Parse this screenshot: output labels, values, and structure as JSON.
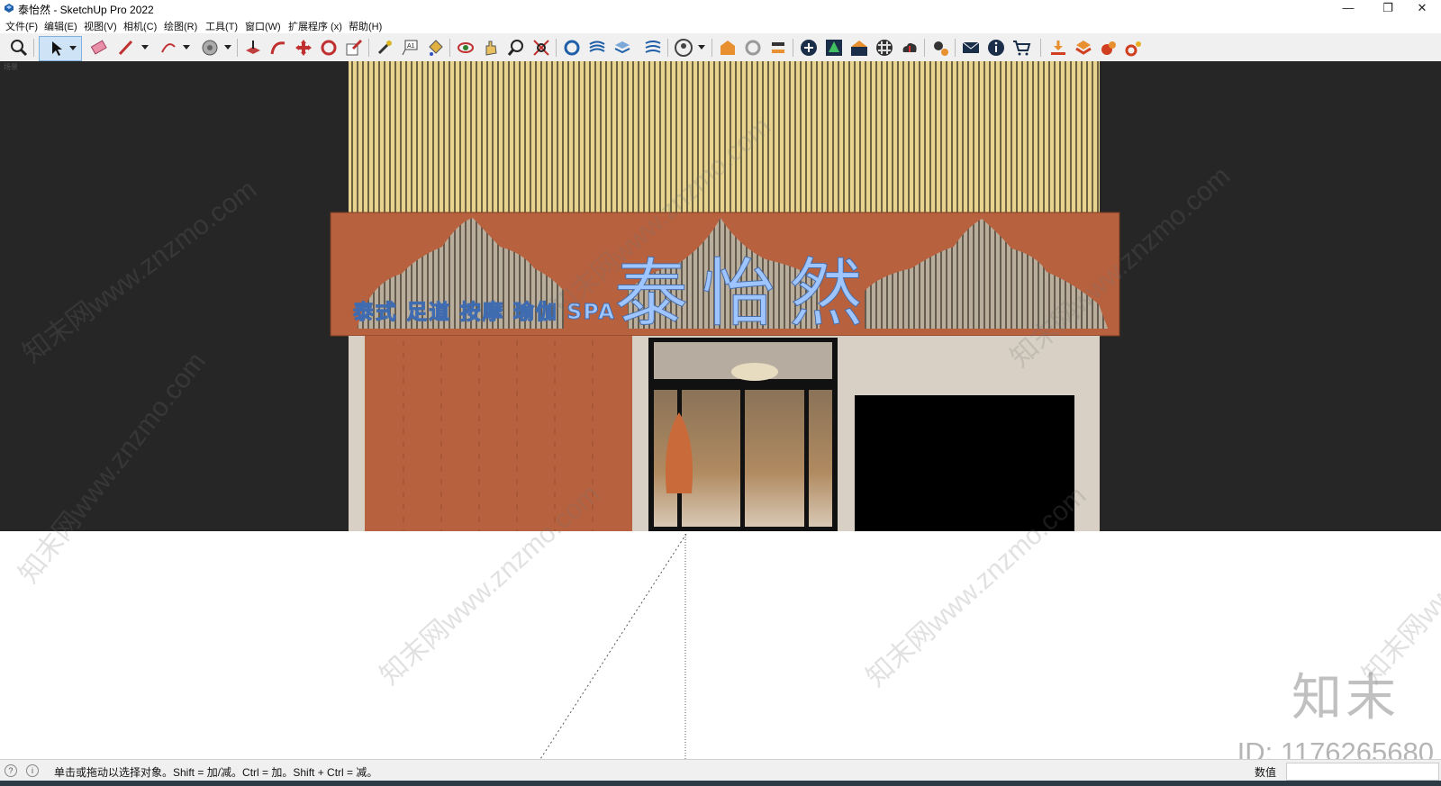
{
  "window": {
    "title": "泰怡然 - SketchUp Pro 2022",
    "minimize_glyph": "—",
    "restore_glyph": "❐",
    "close_glyph": "✕"
  },
  "menu": [
    {
      "label": "文件(F)"
    },
    {
      "label": "编辑(E)"
    },
    {
      "label": "视图(V)"
    },
    {
      "label": "相机(C)"
    },
    {
      "label": "绘图(R)"
    },
    {
      "label": "工具(T)"
    },
    {
      "label": "窗口(W)"
    },
    {
      "label": "扩展程序 (x)"
    },
    {
      "label": "帮助(H)"
    }
  ],
  "toolbar": {
    "icons": [
      "zoom-extents-icon",
      "select-arrow-icon",
      "eraser-icon",
      "pencil-icon",
      "arc-icon",
      "protractor-icon",
      "push-pull-icon",
      "follow-me-icon",
      "move-icon",
      "rotate-icon",
      "scale-icon",
      "tape-measure-icon",
      "text-icon",
      "paint-bucket-icon",
      "orbit-icon",
      "pan-icon",
      "zoom-icon",
      "zoom-window-icon",
      "section-plane-icon",
      "component-icon",
      "layers-icon",
      "sandbox-icon",
      "profile-icon",
      "warehouse-icon",
      "refresh-icon",
      "share-icon",
      "add-icon",
      "tree-icon",
      "style-icon",
      "texture-icon",
      "cloud-upload-icon",
      "settings-icon",
      "mail-icon",
      "info-icon",
      "cart-icon",
      "import-icon",
      "layout-icon",
      "extension-icon",
      "gear-group-icon"
    ]
  },
  "scene": {
    "tab_label": "场景",
    "sign_big_text": "泰 怡 然",
    "sign_small_text": "泰式 足道 按摩 瑜伽 SPA",
    "colors": {
      "background": "#262626",
      "top_panel": "#e8d48f",
      "sign_board": "#b8613e",
      "wall": "#d8d0c4",
      "door_frame": "#111111",
      "sign_text": "#9ec5ff",
      "ground": "#ffffff"
    }
  },
  "watermarks": {
    "text": "知末网www.znzmo.com",
    "brand": "知末",
    "id": "ID: 1176265680"
  },
  "status": {
    "message": "单击或拖动以选择对象。Shift = 加/减。Ctrl = 加。Shift + Ctrl = 减。",
    "measurements_label": "数值",
    "measurements_value": ""
  }
}
